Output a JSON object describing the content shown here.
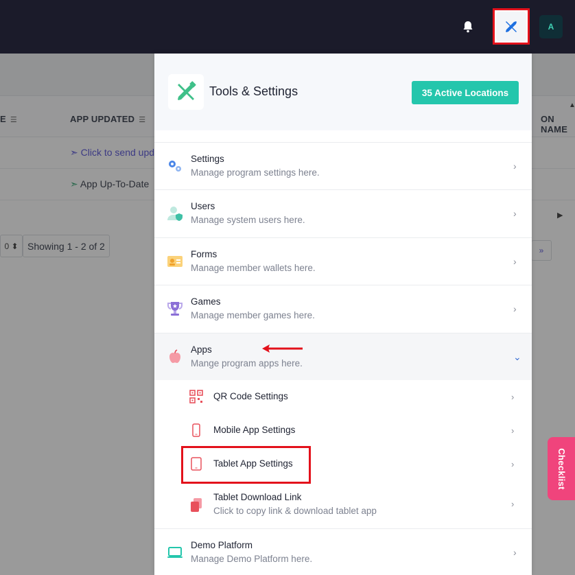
{
  "topbar": {
    "avatar_initial": "A"
  },
  "background_table": {
    "columns": [
      "E",
      "APP UPDATED",
      "ON NAME"
    ],
    "rows": [
      {
        "app_updated": "Click to send upd"
      },
      {
        "app_updated": "App Up-To-Date"
      }
    ],
    "per_page_partial": "0",
    "showing": "Showing 1 - 2 of 2",
    "pager_next": "»"
  },
  "panel": {
    "title": "Tools & Settings",
    "badge": "35 Active Locations",
    "items": [
      {
        "title": "Settings",
        "desc": "Manage program settings here.",
        "icon": "gears-icon",
        "color": "#4a86e8"
      },
      {
        "title": "Users",
        "desc": "Manage system users here.",
        "icon": "user-shield-icon",
        "color": "#3fc0a6"
      },
      {
        "title": "Forms",
        "desc": "Manage member wallets here.",
        "icon": "id-card-icon",
        "color": "#f6b73c"
      },
      {
        "title": "Games",
        "desc": "Manage member games here.",
        "icon": "trophy-icon",
        "color": "#8b6fd6"
      },
      {
        "title": "Apps",
        "desc": "Mange program apps here.",
        "icon": "apple-icon",
        "color": "#f07080"
      }
    ],
    "sub_items": [
      {
        "title": "QR Code Settings",
        "icon": "qr-code-icon"
      },
      {
        "title": "Mobile App Settings",
        "icon": "mobile-icon"
      },
      {
        "title": "Tablet App Settings",
        "icon": "tablet-icon"
      },
      {
        "title": "Tablet Download Link",
        "desc": "Click to copy link & download tablet app",
        "icon": "copy-icon"
      }
    ],
    "bottom_item": {
      "title": "Demo Platform",
      "desc": "Manage Demo Platform here.",
      "icon": "laptop-icon",
      "color": "#24c6ac"
    }
  },
  "checklist_label": "Checklist",
  "colors": {
    "topbar": "#1b1b2a",
    "accent_teal": "#24c6ac",
    "highlight_red": "#e3111b",
    "checklist_pink": "#f0447c",
    "icon_red": "#e8505b"
  }
}
